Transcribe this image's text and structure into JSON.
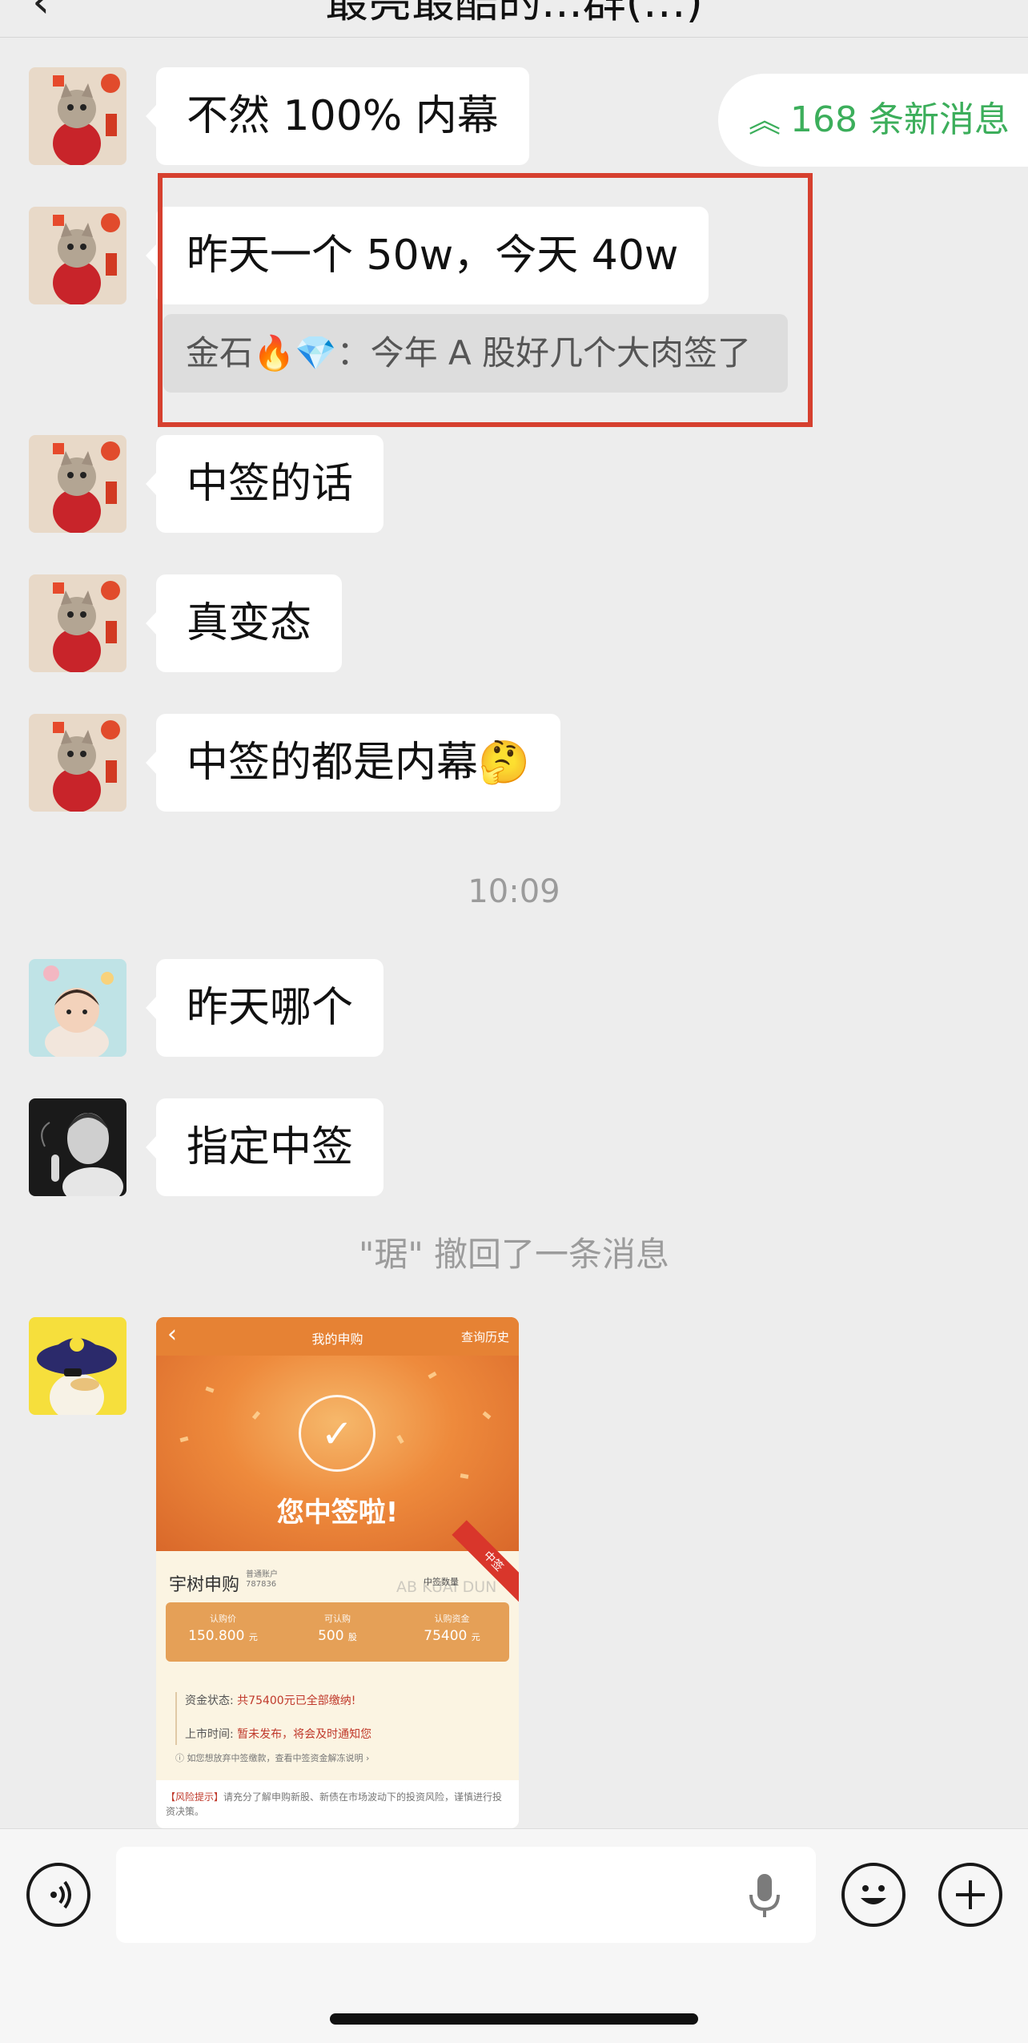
{
  "header": {
    "back_icon": "‹",
    "title": "最亮最酷的...群(…)"
  },
  "new_messages": {
    "label": "168 条新消息"
  },
  "messages": [
    {
      "text": "不然 100% 内幕"
    },
    {
      "text": "昨天一个 50w，今天 40w"
    },
    {
      "text": "中签的话"
    },
    {
      "text": "真变态"
    },
    {
      "text": "中签的都是内幕🤔"
    },
    {
      "text": "昨天哪个"
    },
    {
      "text": "指定中签"
    }
  ],
  "quote": {
    "text": "金石🔥💎：今年 A 股好几个大肉签了"
  },
  "timestamp": "10:09",
  "recall_notice": "\"琚\" 撤回了一条消息",
  "image_card": {
    "nav_title": "我的申购",
    "nav_history": "查询历史",
    "headline": "您中签啦!",
    "ribbon": "中签",
    "stock_name": "宇树申购",
    "account_type": "普通账户",
    "account_no": "787836",
    "count_label": "中签数量",
    "watermark": "AB KUAI DUN",
    "stats": [
      {
        "label": "认购价",
        "value": "150.800",
        "unit": "元"
      },
      {
        "label": "可认购",
        "value": "500",
        "unit": "股"
      },
      {
        "label": "认购资金",
        "value": "75400",
        "unit": "元"
      }
    ],
    "fund_status_label": "资金状态:",
    "fund_status_value": "共75400元已全部缴纳!",
    "listing_label": "上市时间:",
    "listing_value": "暂未发布，将会及时通知您",
    "hint": "ⓘ 如您想放弃中签缴款，查看中签资金解冻说明 ›",
    "risk_tag": "【风险提示】",
    "risk_text": "请充分了解申购新股、新债在市场波动下的投资风险，谨慎进行投资决策。"
  },
  "input_bar": {
    "voice_icon": "voice-icon",
    "mic_icon": "microphone-icon",
    "emoji_icon": "emoji-icon",
    "plus_icon": "plus-icon"
  },
  "colors": {
    "background": "#ededed",
    "bubble": "#ffffff",
    "highlight_border": "#d6402f",
    "new_message_text": "#3cae5b",
    "card_orange": "#e68234"
  }
}
